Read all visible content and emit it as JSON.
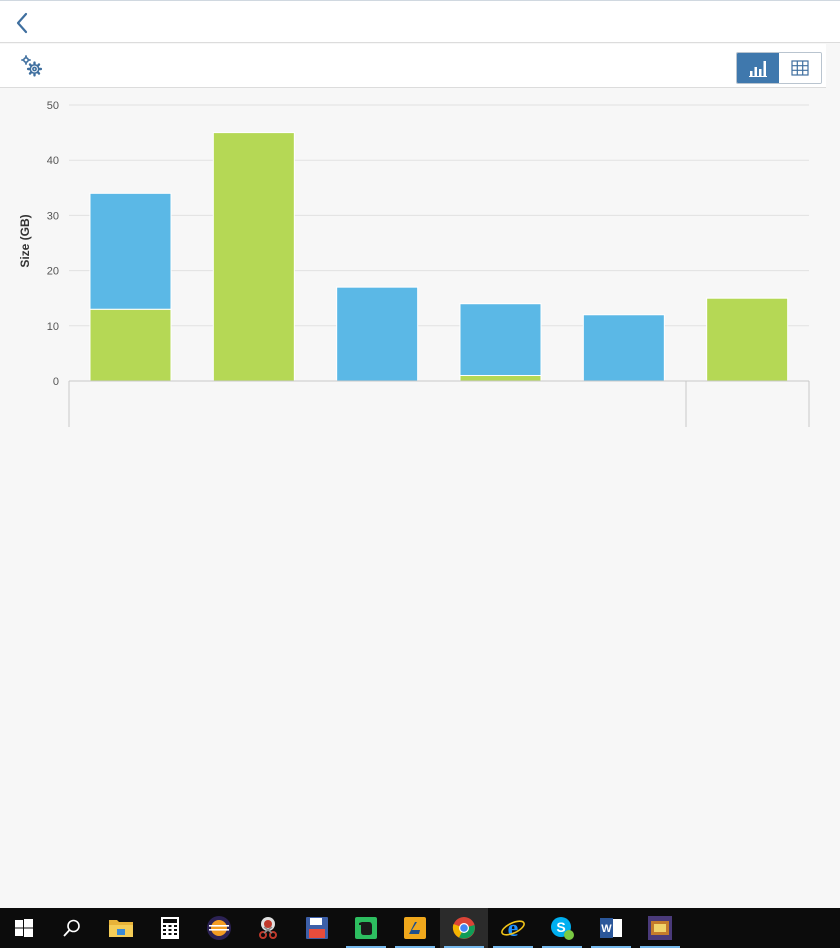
{
  "header": {
    "back_label": ""
  },
  "toolbar": {
    "settings_label": ""
  },
  "view_toggle": {
    "selected": "chart",
    "options": [
      "chart",
      "table"
    ]
  },
  "chart_data": {
    "type": "bar",
    "stacked": true,
    "categories": [
      "",
      "",
      "",
      "",
      "",
      ""
    ],
    "series": [
      {
        "color": "#b5d855",
        "values": [
          13,
          45,
          0,
          1,
          0,
          15
        ]
      },
      {
        "color": "#5bb8e6",
        "values": [
          21,
          0,
          17,
          13,
          12,
          0
        ]
      }
    ],
    "ylabel": "Size (GB)",
    "ylim": [
      0,
      50
    ],
    "yticks": [
      0,
      10,
      20,
      30,
      40,
      50
    ],
    "grid": true,
    "legend": "none"
  },
  "taskbar": {
    "items": [
      {
        "name": "start-icon",
        "running": false
      },
      {
        "name": "search-icon",
        "running": false
      },
      {
        "name": "file-explorer-icon",
        "running": false
      },
      {
        "name": "calculator-icon",
        "running": false
      },
      {
        "name": "eclipse-icon",
        "running": false
      },
      {
        "name": "snipping-tool-icon",
        "running": false
      },
      {
        "name": "save-app-icon",
        "running": false
      },
      {
        "name": "evernote-icon",
        "running": true
      },
      {
        "name": "filezilla-icon",
        "running": true
      },
      {
        "name": "chrome-icon",
        "running": true,
        "active": true
      },
      {
        "name": "internet-explorer-icon",
        "running": true
      },
      {
        "name": "skype-icon",
        "running": true
      },
      {
        "name": "word-icon",
        "running": true
      },
      {
        "name": "game-app-icon",
        "running": true
      }
    ]
  }
}
